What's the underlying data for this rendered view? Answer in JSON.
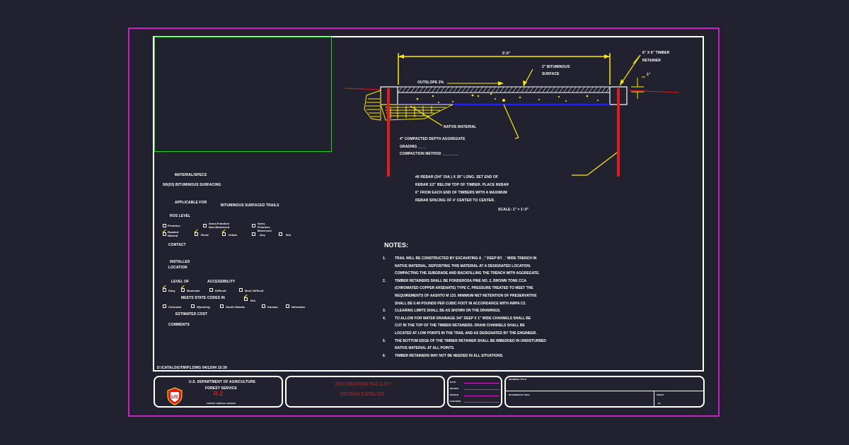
{
  "colors": {
    "background": "#212130",
    "magenta": "#d01cc8",
    "green": "#19d419",
    "yellow": "#ffeb00",
    "red": "#e01c1c",
    "blue": "#2020ff",
    "white": "#ffffff"
  },
  "drawing": {
    "dim_width": "5'-0\"",
    "bituminous": [
      "2\" BITUMINOUS",
      "SURFACE"
    ],
    "timber_retainer": [
      "6\" X 6\" TIMBER",
      "RETAINER"
    ],
    "one_inch": "1\"",
    "outslope": "OUTSLOPE 2%",
    "native_material": "NATIVE MATERIAL",
    "aggregate": [
      "4\" COMPACTED DEPTH AGGREGATE",
      "GRADING ____",
      "COMPACTION METHOD ________"
    ],
    "rebar": [
      "#6 REBAR (3/4\" DIA.) X 30\" LONG.  SET END OF",
      "REBAR 1/2\" BELOW TOP OF TIMBER.   PLACE REBAR",
      "6\" FROM EACH END OF TIMBERS WITH A MAXIMUM",
      "REBAR SPACING OF 4' CENTER TO CENTER."
    ],
    "scale": "SCALE: 1\" = 1'-0\""
  },
  "specs": {
    "material_specs": "MATERIAL/SPECS",
    "material_value": "9/6(03) BITUMINOUS SURFACING",
    "applicable_for": "APPLICABLE FOR",
    "applicable_value": "BITUMINOUS SURFACED TRAILS",
    "ros_level": "ROS LEVEL",
    "ros_options": [
      {
        "label": "Primitive",
        "checked": false
      },
      {
        "label": "Semi-Primitive Non-Motorized",
        "checked": false
      },
      {
        "label": "Semi-Primitive Motorized",
        "checked": false
      },
      {
        "label": "Roaded Natural",
        "checked": true
      },
      {
        "label": "Rural",
        "checked": true
      },
      {
        "label": "Urban",
        "checked": true
      },
      {
        "label": "Any",
        "checked": false
      },
      {
        "label": "N/A",
        "checked": false
      }
    ],
    "contact": "CONTACT",
    "installed_location": [
      "INSTALLED",
      "LOCATION"
    ],
    "level_of": "LEVEL OF",
    "accessibility": "ACCESSIBILITY",
    "access_options": [
      {
        "label": "Easy",
        "checked": true
      },
      {
        "label": "Moderate",
        "checked": true
      },
      {
        "label": "Difficult",
        "checked": false
      },
      {
        "label": "Most Difficult",
        "checked": false
      },
      {
        "label": "N/A",
        "checked": true
      }
    ],
    "meets_state_codes": "MEETS STATE CODES IN",
    "states": [
      {
        "label": "Colorado",
        "checked": false
      },
      {
        "label": "Wyoming",
        "checked": false
      },
      {
        "label": "South Dakota",
        "checked": false
      },
      {
        "label": "Kansas",
        "checked": false
      },
      {
        "label": "Nebraska",
        "checked": false
      }
    ],
    "estimated_cost": "ESTIMATED COST",
    "comments": "COMMENTS"
  },
  "notes": {
    "title": "NOTES:",
    "items": [
      {
        "num": "1.",
        "lines": [
          "TRAIL WILL BE CONSTRUCTED BY EXCAVATING A _\" DEEP BY _' WIDE TRENCH IN",
          "NATIVE MATERIAL, DEPOSITING THIS MATERIAL AT A DESIGNATED LOCATION.",
          "COMPACTING THE SUBGRADE AND BACKFILLING THE TRENCH WITH AGGREGATE."
        ]
      },
      {
        "num": "2.",
        "lines": [
          "TIMBER RETAINERS SHALL BE PONDEROSA PINE NO. 2, BROWN TONE CCA",
          "(CHROMATED COPPER ARSENATE) TYPE C, PRESSURE TREATED TO MEET THE",
          "REQUIREMENTS OF AASHTO M 133.  MINIMUM NET RETENTION OF PRESERVATIVE",
          "SHALL BE 0.40 POUNDS PER CUBIC FOOT IN ACCORDANCE WITH AWPA C2."
        ]
      },
      {
        "num": "3.",
        "lines": [
          "CLEARING LIMITS SHALL BE AS SHOWN ON THE DRAWINGS."
        ]
      },
      {
        "num": "4.",
        "lines": [
          "TO ALLOW FOR WATER DRAINAGE 3/4\" DEEP X 1\" WIDE CHANNELS SHALL BE",
          "CUT IN THE TOP OF THE TIMBER RETAINERS.  DRAIN CHANNELS SHALL BE",
          "LOCATED AT LOW POINTS IN THE TRAIL AND AS DESIGNATED BY THE ENGINEER."
        ]
      },
      {
        "num": "5.",
        "lines": [
          "THE BOTTOM EDGE OF THE TIMBER RETAINER SHALL BE IMBEDDED IN UNDISTURBED",
          "NATIVE MATERIAL AT ALL POINTS."
        ]
      },
      {
        "num": "6.",
        "lines": [
          "TIMBER RETAINERS MAY NOT BE NEEDED IN ALL SITUATIONS."
        ]
      }
    ]
  },
  "file_path": "D:\\CATALOG\\TM\\P1.DWG 04/12/94 15:39",
  "title_block": {
    "dept": "U.S. DEPARTMENT OF AGRICULTURE",
    "service": "FOREST SERVICE",
    "region": "R-2",
    "sub": "FOREST SERVICE REGION",
    "logo_text": "US",
    "catalog": [
      "RECREATION FACILITY",
      "DESIGN CATALOG"
    ],
    "fields": [
      "DATE",
      "DRAWN",
      "DESIGN",
      "CHECKED"
    ],
    "drawing_title": "DRAWING TITLE",
    "surface_label": "BITUMINOUS TRAIL",
    "sheet_label": "SHEET",
    "sheet_no": "22"
  }
}
